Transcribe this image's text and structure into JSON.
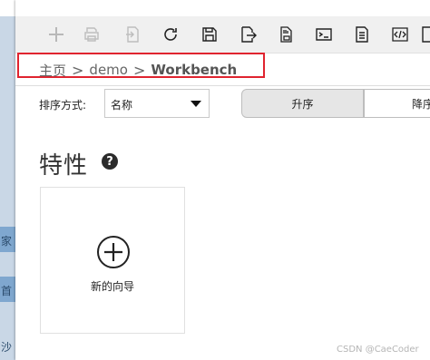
{
  "breadcrumb": {
    "home": "主页",
    "sep1": ">",
    "demo": "demo",
    "sep2": ">",
    "current": "Workbench"
  },
  "sort": {
    "label": "排序方式:",
    "selected": "名称",
    "asc_label": "升序",
    "desc_label": "降序"
  },
  "section": {
    "title": "特性",
    "help": "?"
  },
  "wizard": {
    "label": "新的向导"
  },
  "watermark": "CSDN @CaeCoder",
  "left_strip": {
    "chars": [
      "家",
      "首",
      "沙"
    ]
  },
  "toolbar": {
    "icons": [
      "plus-icon",
      "print-icon",
      "import-icon",
      "refresh-icon",
      "save-icon",
      "export-icon",
      "sd-card-icon",
      "terminal-icon",
      "document-icon",
      "code-icon",
      "partial-icon"
    ]
  },
  "colors": {
    "highlight_border": "#e0242f",
    "toolbar_bg": "#f0f0f0",
    "asc_bg": "#e6e6e6"
  }
}
